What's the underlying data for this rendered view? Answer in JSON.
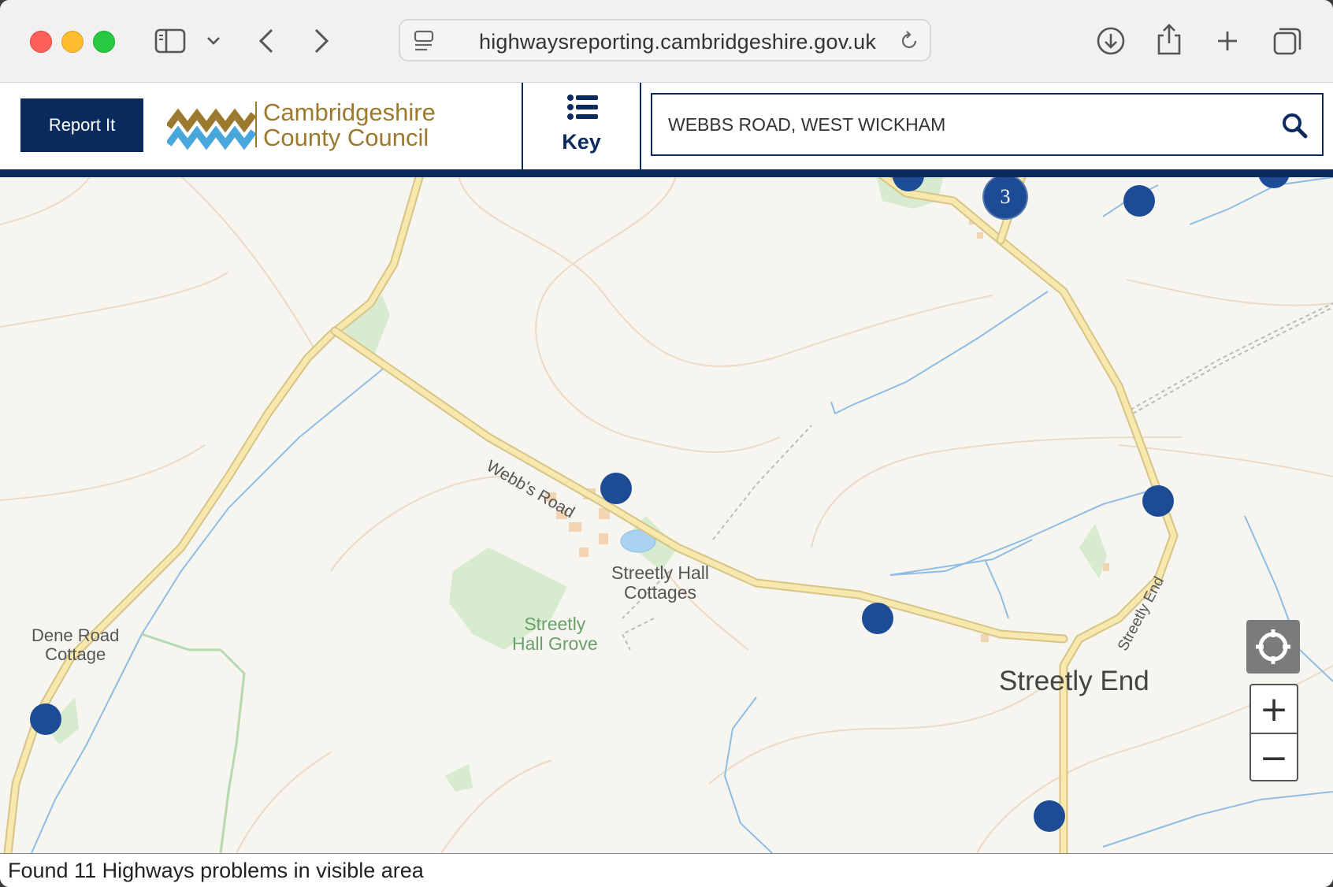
{
  "browser": {
    "url": "highwaysreporting.cambridgeshire.gov.uk"
  },
  "header": {
    "report_button": "Report It",
    "logo_line1": "Cambridgeshire",
    "logo_line2": "County Council",
    "key_label": "Key",
    "search_value": "WEBBS ROAD, WEST WICKHAM"
  },
  "map": {
    "labels": {
      "webbs_road": "Webb's Road",
      "streetly_hall_cottages_1": "Streetly Hall",
      "streetly_hall_cottages_2": "Cottages",
      "streetly_hall_grove_1": "Streetly",
      "streetly_hall_grove_2": "Hall Grove",
      "dene_road_cottage_1": "Dene Road",
      "dene_road_cottage_2": "Cottage",
      "streetly_end": "Streetly End",
      "streetly_end_road": "Streetly End"
    },
    "cluster_count": "3",
    "zoom_in": "+",
    "zoom_out": "−"
  },
  "status": {
    "text": "Found 11 Highways problems in visible area"
  },
  "colors": {
    "brand_navy": "#0b2a5e",
    "marker_blue": "#1e4b95",
    "road_yellow": "#f5e3a3",
    "water_blue": "#7fb1dd",
    "green_area": "#cde7c6"
  }
}
